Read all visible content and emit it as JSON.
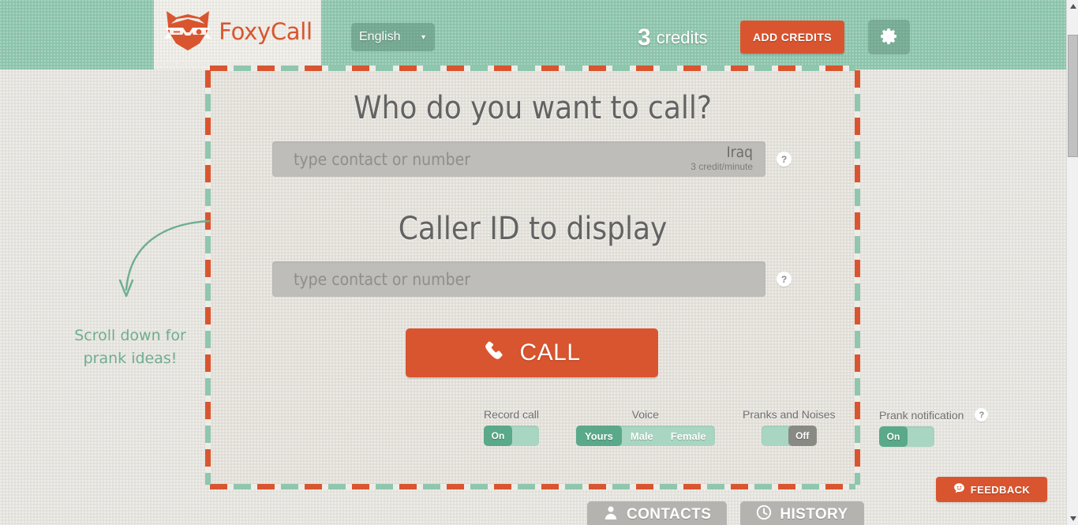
{
  "header": {
    "logo": {
      "text": "FoxyCall",
      "icon": "fox-head-glasses-icon",
      "brand_color": "#d9552f"
    },
    "language": {
      "label": "English",
      "caret": "▼"
    },
    "credits": {
      "count": "3",
      "word": "credits"
    },
    "add_credits_label": "ADD CREDITS",
    "settings_icon": "gear-icon",
    "bg_color": "#8fc6ae"
  },
  "card": {
    "border_colors": {
      "orange": "#d9552f",
      "green": "#8fc6ae"
    },
    "bg_color": "#e3e0da",
    "call_section": {
      "title": "Who do you want to call?",
      "input_placeholder": "type contact or number",
      "input_value": "",
      "rate_country": "Iraq",
      "rate_price": "3 credit/minute",
      "help_label": "?"
    },
    "callerid_section": {
      "title": "Caller ID to display",
      "input_placeholder": "type contact or number",
      "input_value": "",
      "help_label": "?"
    },
    "call_button": {
      "label": "CALL",
      "icon": "phone-handset-icon",
      "color": "#d9552f"
    },
    "toggles": [
      {
        "name": "record-call",
        "label": "Record call",
        "type": "switch",
        "state_label": "On",
        "state": "on",
        "has_help": false
      },
      {
        "name": "voice",
        "label": "Voice",
        "type": "segmented",
        "options": [
          "Yours",
          "Male",
          "Female"
        ],
        "selected": "Yours",
        "has_help": false
      },
      {
        "name": "pranks-and-noises",
        "label": "Pranks and Noises",
        "type": "switch",
        "state_label": "Off",
        "state": "off",
        "has_help": false
      },
      {
        "name": "prank-notification",
        "label": "Prank notification",
        "type": "switch",
        "state_label": "On",
        "state": "on",
        "has_help": true,
        "help_label": "?"
      }
    ]
  },
  "annotation": {
    "line1": "Scroll down for",
    "line2": "prank ideas!",
    "arrow_icon": "curved-down-arrow-icon",
    "color": "#6fae8f"
  },
  "bottom_tabs": [
    {
      "name": "contacts",
      "label": "CONTACTS",
      "icon": "person-icon"
    },
    {
      "name": "history",
      "label": "HISTORY",
      "icon": "clock-icon"
    }
  ],
  "feedback": {
    "label": "FEEDBACK",
    "icon": "speech-bubble-smiley-icon",
    "color": "#d9552f"
  },
  "scrollbar": {
    "up_arrow": "▲",
    "down_arrow": "▼"
  }
}
